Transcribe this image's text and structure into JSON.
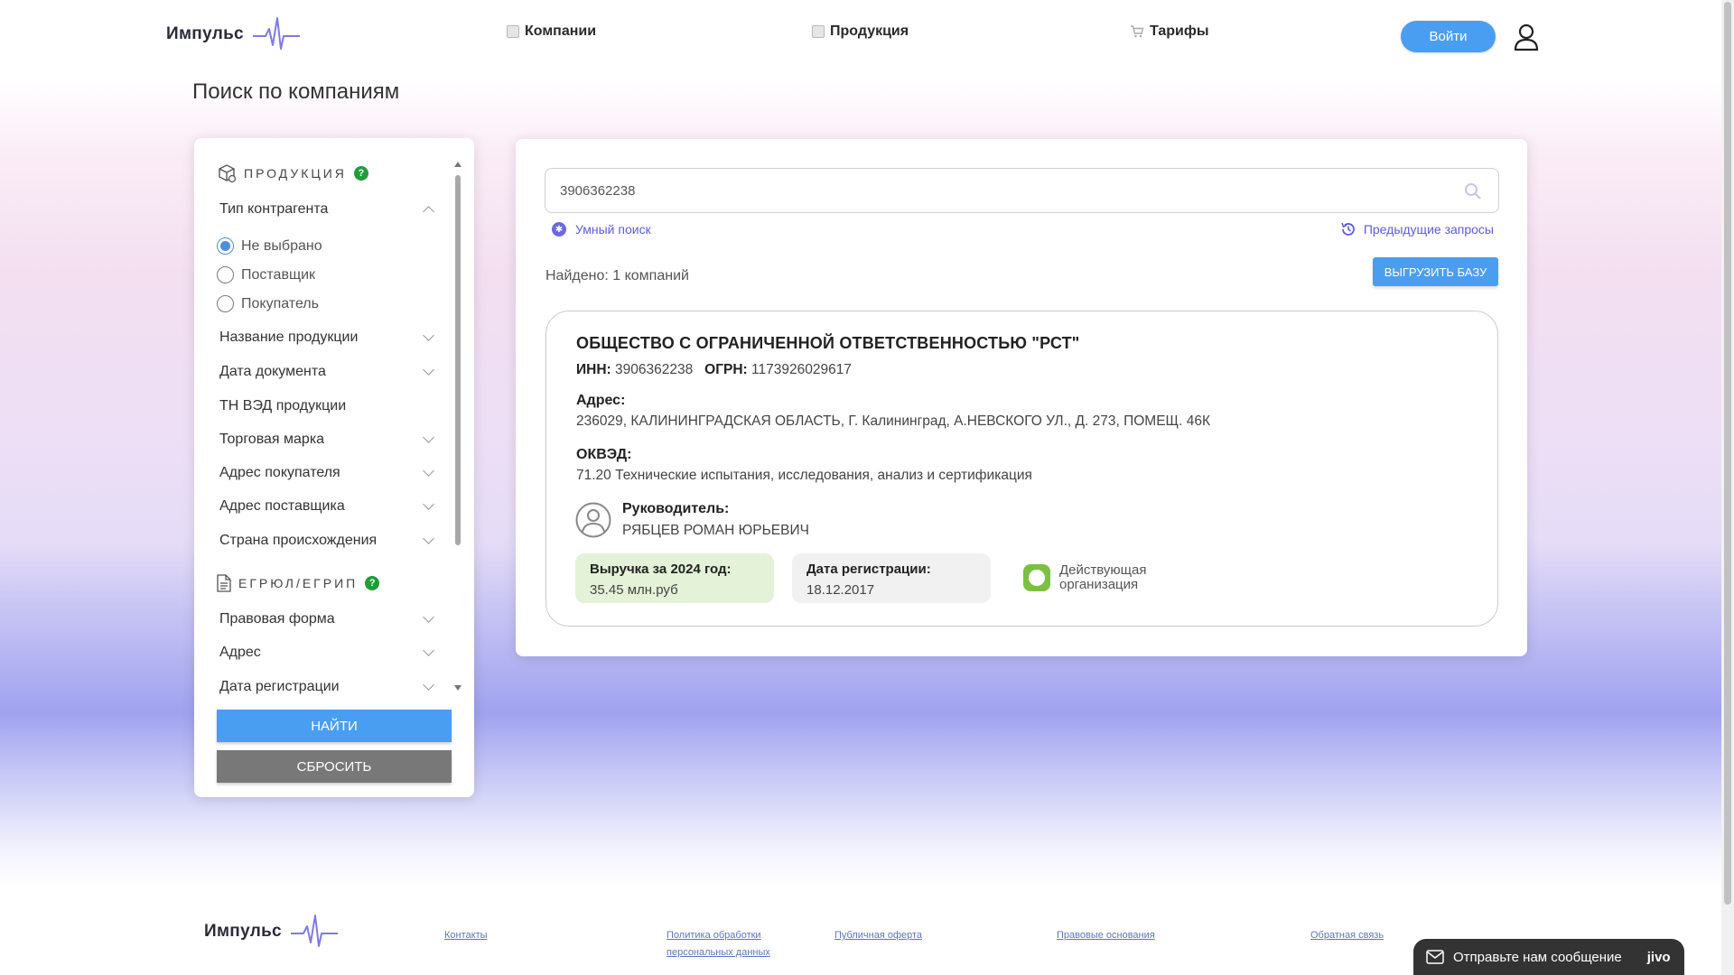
{
  "header": {
    "logo_text": "Импульс",
    "nav": [
      {
        "label": "Компании",
        "icon": "companies-icon"
      },
      {
        "label": "Продукция",
        "icon": "products-icon"
      },
      {
        "label": "Тарифы",
        "icon": "cart-icon"
      }
    ],
    "login_label": "Войти"
  },
  "page_title": "Поиск по компаниям",
  "sidebar": {
    "section_products": "ПРОДУКЦИЯ",
    "counterparty_type": {
      "label": "Тип контрагента",
      "options": [
        "Не выбрано",
        "Поставщик",
        "Покупатель"
      ],
      "selected": "Не выбрано"
    },
    "product_filters": [
      "Название продукции",
      "Дата документа",
      "ТН ВЭД продукции",
      "Торговая марка",
      "Адрес покупателя",
      "Адрес поставщика",
      "Страна происхождения"
    ],
    "section_registry": "ЕГРЮЛ/ЕГРИП",
    "registry_filters": [
      "Правовая форма",
      "Адрес",
      "Дата регистрации"
    ],
    "find_label": "НАЙТИ",
    "reset_label": "СБРОСИТЬ"
  },
  "main": {
    "search_value": "3906362238",
    "smart_search": "Умный поиск",
    "previous_queries": "Предыдущие запросы",
    "found_text": "Найдено: 1 компаний",
    "export_label": "ВЫГРУЗИТЬ БАЗУ",
    "company": {
      "name": "ОБЩЕСТВО С ОГРАНИЧЕННОЙ ОТВЕТСТВЕННОСТЬЮ \"РСТ\"",
      "inn_label": "ИНН:",
      "inn": "3906362238",
      "ogrn_label": "ОГРН:",
      "ogrn": "1173926029617",
      "address_label": "Адрес:",
      "address": "236029, КАЛИНИНГРАДСКАЯ ОБЛАСТЬ, Г. Калининград, А.НЕВСКОГО УЛ., Д. 273, ПОМЕЩ. 46К",
      "okved_label": "ОКВЭД:",
      "okved": "71.20 Технические испытания, исследования, анализ и сертификация",
      "manager_label": "Руководитель:",
      "manager": "РЯБЦЕВ РОМАН ЮРЬЕВИЧ",
      "revenue_label": "Выручка за 2024 год:",
      "revenue": "35.45 млн.руб",
      "reg_date_label": "Дата регистрации:",
      "reg_date": "18.12.2017",
      "status": "Действующая организация",
      "status_color": "#7bc043"
    }
  },
  "footer": {
    "logo_text": "Импульс",
    "links": [
      "Контакты",
      "Политика обработки персональных данных",
      "Публичная оферта",
      "Правовые основания",
      "Обратная связь"
    ]
  },
  "chat": {
    "label": "Отправьте нам сообщение",
    "brand": "jivo"
  },
  "colors": {
    "accent": "#4a9ef2",
    "link": "#5b5be0",
    "help": "#1f9d3a",
    "revenue_tile": "#e4f2d8",
    "date_tile": "#f1f1f1"
  }
}
